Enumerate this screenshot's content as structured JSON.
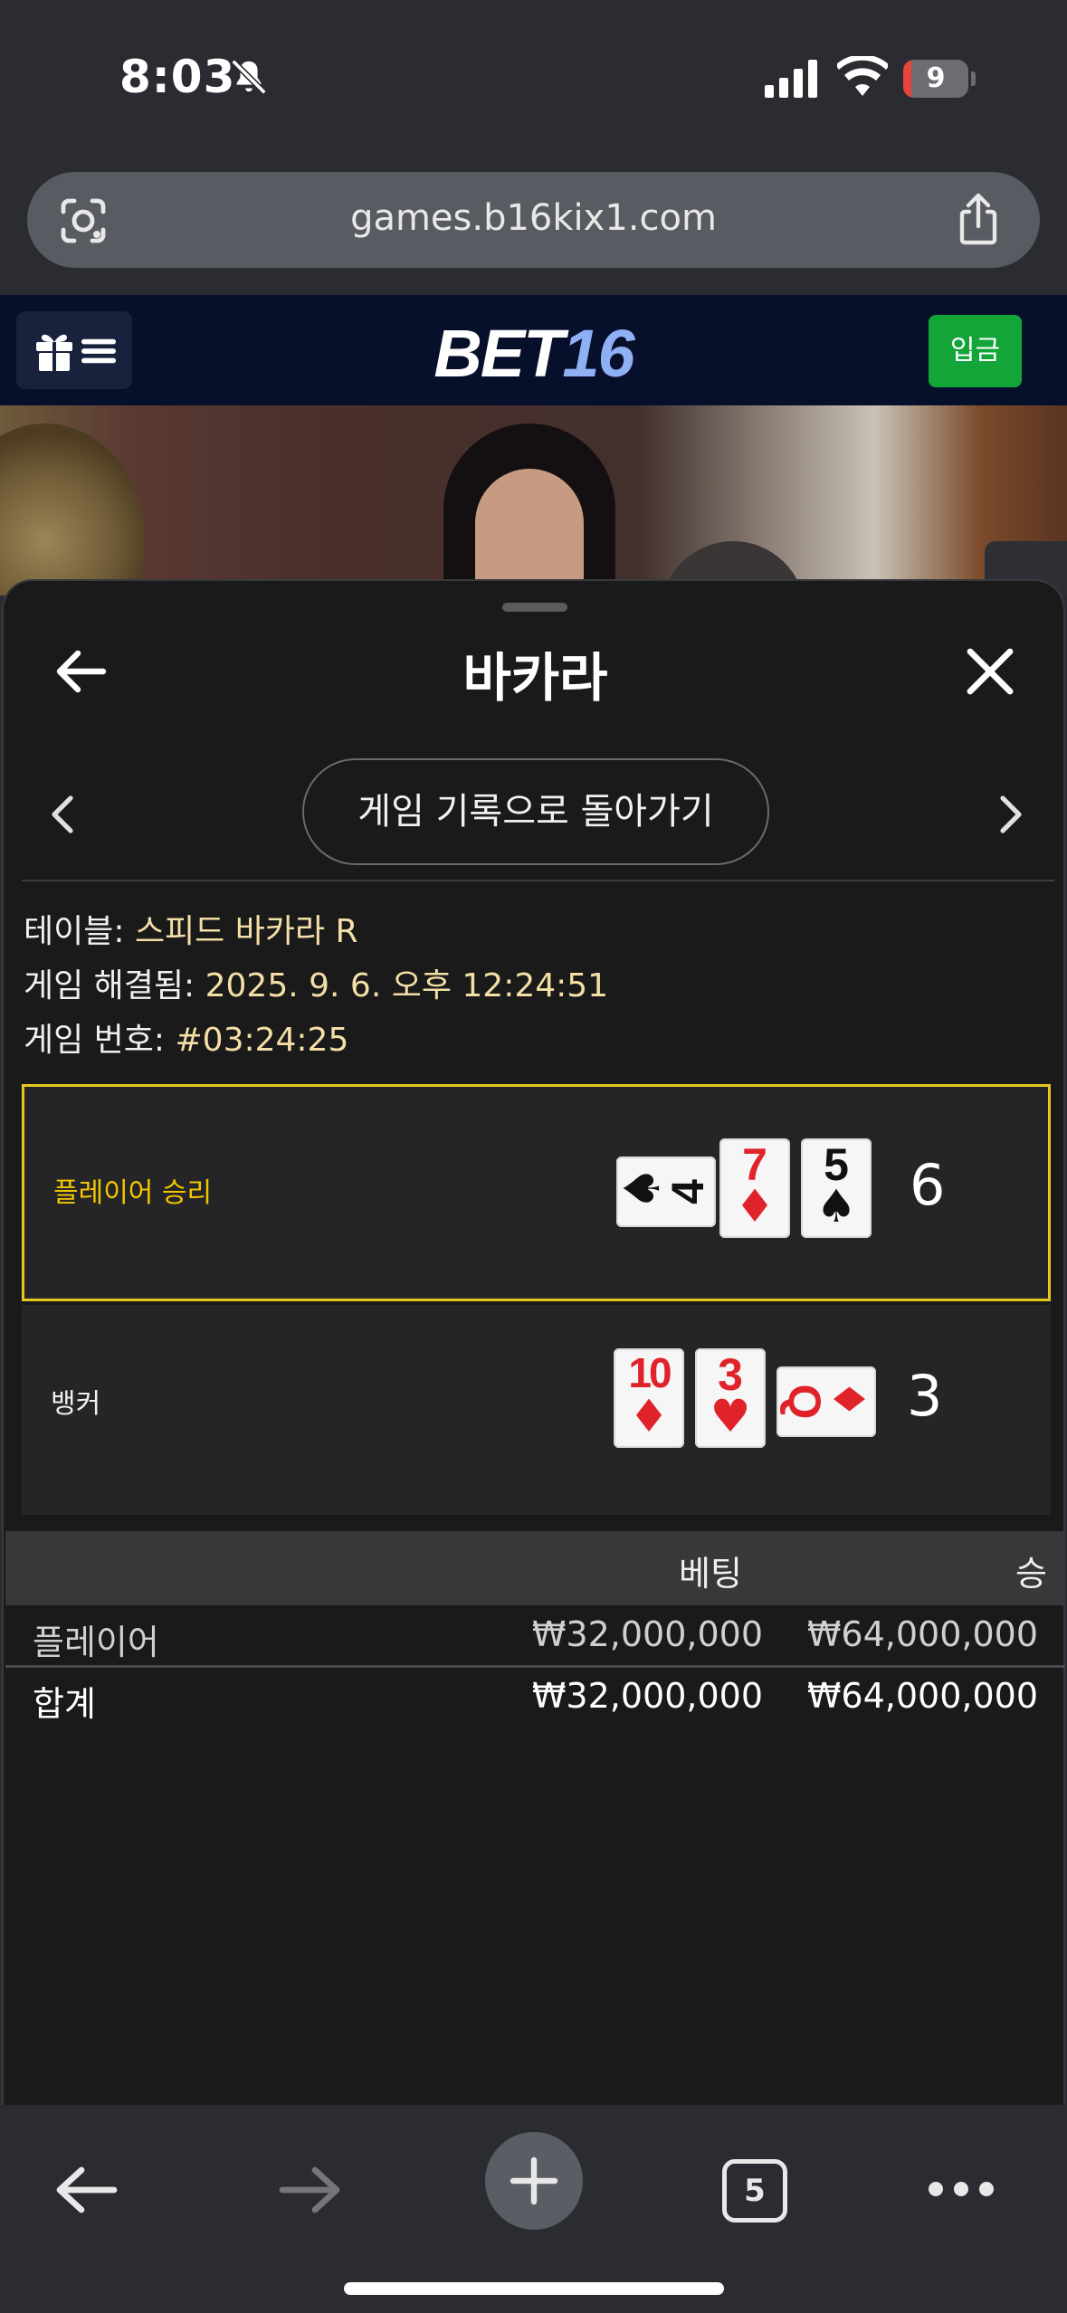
{
  "status_bar": {
    "time": "8:03",
    "battery": "9"
  },
  "browser": {
    "url": "games.b16kix1.com",
    "tab_count": "5"
  },
  "site": {
    "logo_part1": "BET",
    "logo_part2": "16",
    "deposit_label": "입금"
  },
  "sheet": {
    "title": "바카라",
    "back_to_history": "게임 기록으로 돌아가기",
    "info": [
      {
        "label": "테이블: ",
        "value": "스피드 바카라 R"
      },
      {
        "label": "게임 해결됨: ",
        "value": "2025. 9. 6. 오후 12:24:51"
      },
      {
        "label": "게임 번호: ",
        "value": "#03:24:25"
      }
    ],
    "player": {
      "label": "플레이어 승리",
      "score": "6",
      "cards": [
        {
          "rank": "4",
          "suit": "♠",
          "color": "black",
          "rotated": true
        },
        {
          "rank": "7",
          "suit": "♦",
          "color": "red",
          "rotated": false
        },
        {
          "rank": "5",
          "suit": "♠",
          "color": "black",
          "rotated": false
        }
      ]
    },
    "banker": {
      "label": "뱅커",
      "score": "3",
      "cards": [
        {
          "rank": "10",
          "suit": "♦",
          "color": "red",
          "rotated": false
        },
        {
          "rank": "3",
          "suit": "♥",
          "color": "red",
          "rotated": false
        },
        {
          "rank": "Q",
          "suit": "♦",
          "color": "red",
          "rotated": true
        }
      ]
    },
    "bets": {
      "col_bet": "베팅",
      "col_win": "승",
      "rows": [
        {
          "name": "플레이어",
          "bet": "₩32,000,000",
          "win": "₩64,000,000"
        },
        {
          "name": "합계",
          "bet": "₩32,000,000",
          "win": "₩64,000,000"
        }
      ]
    }
  },
  "colors": {
    "winner_border": "#e6c81a",
    "deposit": "#13a538",
    "header_bg": "#07102b"
  }
}
